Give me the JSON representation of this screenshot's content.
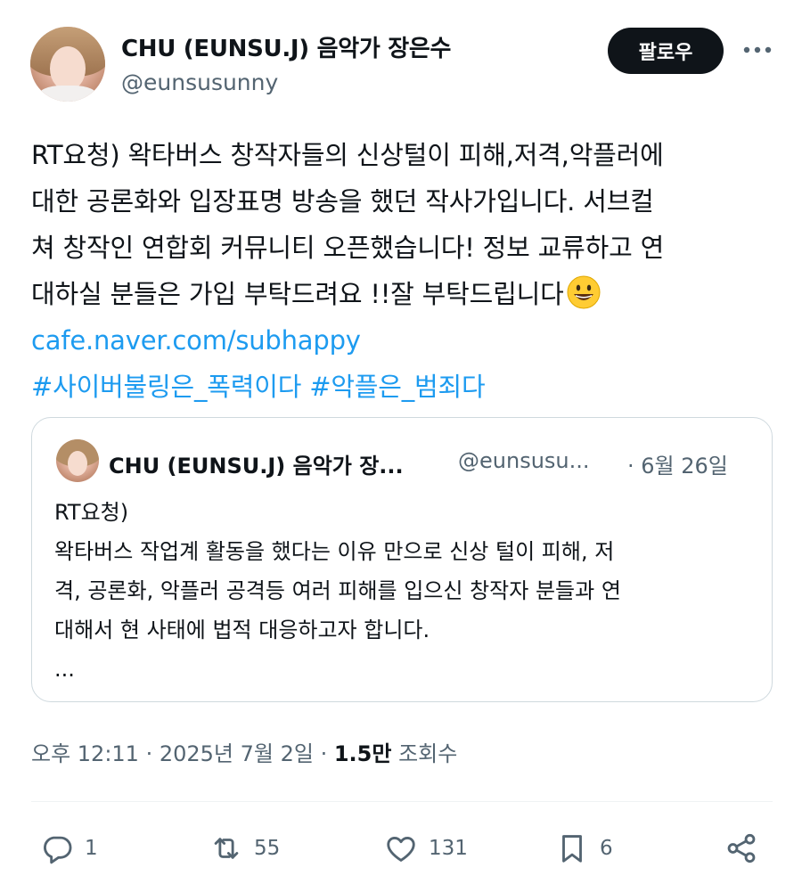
{
  "author": {
    "name": "CHU (EUNSU.J) 음악가 장은수",
    "handle": "@eunsusunny"
  },
  "follow_label": "팔로우",
  "more_icon": "more-horizontal-icon",
  "post": {
    "lines": [
      "RT요청) 왁타버스 창작자들의 신상털이 피해,저격,악플러에",
      "대한 공론화와 입장표명 방송을 했던 작사가입니다. 서브컬",
      "쳐 창작인 연합회 커뮤니티 오픈했습니다! 정보 교류하고 연",
      "대하실 분들은 가입 부탁드려요 !!잘 부탁드립니다"
    ],
    "emoji": "grinning-face-emoji",
    "link": "cafe.naver.com/subhappy",
    "hashtags": "#사이버불링은_폭력이다 #악플은_범죄다"
  },
  "quote": {
    "name": "CHU (EUNSU.J) 음악가 장...",
    "handle": "@eunsusu...",
    "date": "· 6월 26일",
    "lines": [
      "RT요청)",
      "왁타버스 작업계 활동을 했다는 이유 만으로 신상 털이 피해, 저",
      "격, 공론화, 악플러 공격등 여러 피해를 입으신 창작자 분들과 연",
      "대해서 현 사태에 법적 대응하고자 합니다.",
      "..."
    ]
  },
  "meta": {
    "time": "오후 12:11 · 2025년 7월 2일 · ",
    "views": "1.5만",
    "views_label": " 조회수"
  },
  "actions": {
    "reply_count": "1",
    "repost_count": "55",
    "like_count": "131",
    "bookmark_count": "6"
  },
  "colors": {
    "accent": "#1d9bf0",
    "text": "#0f1419",
    "secondary": "#536471",
    "border": "#cfd9de"
  }
}
